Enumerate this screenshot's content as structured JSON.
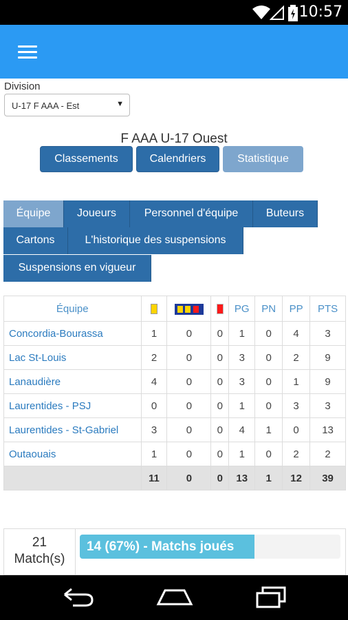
{
  "status_bar": {
    "time": "10:57"
  },
  "division": {
    "label": "Division",
    "selected": "U-17 F AAA - Est"
  },
  "title": "F AAA U-17 Ouest",
  "view_buttons": [
    "Classements",
    "Calendriers",
    "Statistique"
  ],
  "tabs": [
    "Équipe",
    "Joueurs",
    "Personnel d'équipe",
    "Buteurs",
    "Cartons",
    "L'historique des suspensions",
    "Suspensions en vigueur"
  ],
  "table": {
    "header_team": "Équipe",
    "headers": [
      "PG",
      "PN",
      "PP",
      "PTS"
    ],
    "rows": [
      {
        "team": "Concordia-Bourassa",
        "values": [
          "1",
          "0",
          "0",
          "1",
          "0",
          "4",
          "3"
        ]
      },
      {
        "team": "Lac St-Louis",
        "values": [
          "2",
          "0",
          "0",
          "3",
          "0",
          "2",
          "9"
        ]
      },
      {
        "team": "Lanaudière",
        "values": [
          "4",
          "0",
          "0",
          "3",
          "0",
          "1",
          "9"
        ]
      },
      {
        "team": "Laurentides - PSJ",
        "values": [
          "0",
          "0",
          "0",
          "1",
          "0",
          "3",
          "3"
        ]
      },
      {
        "team": "Laurentides - St-Gabriel",
        "values": [
          "3",
          "0",
          "0",
          "4",
          "1",
          "0",
          "13"
        ]
      },
      {
        "team": "Outaouais",
        "values": [
          "1",
          "0",
          "0",
          "1",
          "0",
          "2",
          "2"
        ]
      }
    ],
    "totals": [
      "11",
      "0",
      "0",
      "13",
      "1",
      "12",
      "39"
    ]
  },
  "summary": {
    "count": "21",
    "count_label": "Match(s)",
    "progress_text": "14 (67%) - Matchs joués",
    "progress_percent": 67
  },
  "colors": {
    "app_bar": "#2b9af3",
    "button": "#2d6da8",
    "button_disabled": "#7ea6cd",
    "progress": "#5bc0de"
  }
}
